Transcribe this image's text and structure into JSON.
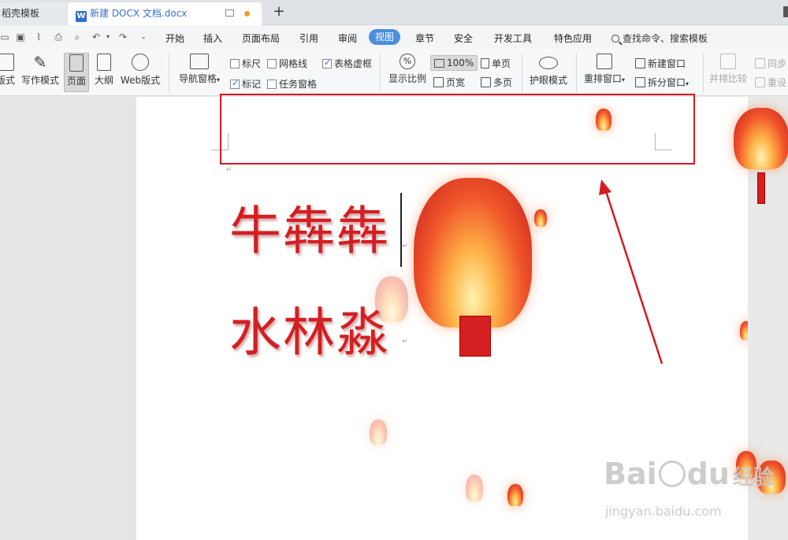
{
  "tabs": [
    {
      "label": "稻壳模板",
      "active": false
    },
    {
      "label": "新建 DOCX 文档.docx",
      "active": true,
      "icon": "wps-writer-icon",
      "unsaved_dot_color": "#f39a2b"
    }
  ],
  "tab_icon_letter": "W",
  "new_tab": "+",
  "menu": {
    "items": [
      "开始",
      "插入",
      "页面布局",
      "引用",
      "审阅",
      "视图",
      "章节",
      "安全",
      "开发工具",
      "特色应用"
    ],
    "active": "视图",
    "search_label": "查找命令、搜索模板"
  },
  "ribbon": {
    "view_modes": [
      {
        "label": "版式",
        "icon": "layout-icon"
      },
      {
        "label": "写作模式",
        "icon": "pen-icon"
      },
      {
        "label": "页面",
        "icon": "page-icon",
        "selected": true
      },
      {
        "label": "大纲",
        "icon": "outline-icon"
      },
      {
        "label": "Web版式",
        "icon": "web-icon"
      }
    ],
    "nav_pane": {
      "label": "导航窗格",
      "icon": "nav-pane-icon"
    },
    "checkboxes": [
      {
        "label": "标尺",
        "checked": false
      },
      {
        "label": "网格线",
        "checked": false
      },
      {
        "label": "表格虚框",
        "checked": true
      },
      {
        "label": "标记",
        "checked": true
      },
      {
        "label": "任务窗格",
        "checked": false
      }
    ],
    "zoom": {
      "label": "显示比例",
      "value": "100%",
      "page_width": "页宽",
      "single_page": "单页",
      "multi_page": "多页"
    },
    "eye_mode": {
      "label": "护眼模式",
      "icon": "eye-icon"
    },
    "windows": {
      "rearrange": "重排窗口",
      "new_window": "新建窗口",
      "split": "拆分窗口",
      "compare": "并排比较",
      "sync": "同步",
      "reset": "重设"
    }
  },
  "document": {
    "line1": "牛犇犇",
    "line2": "水林淼",
    "text_color": "#d41f22"
  },
  "annotation": {
    "rect_color": "#d41a22"
  },
  "watermark": {
    "brand_a": "Bai",
    "brand_b": "du",
    "brand_cn": "经验",
    "url": "jingyan.baidu.com"
  }
}
